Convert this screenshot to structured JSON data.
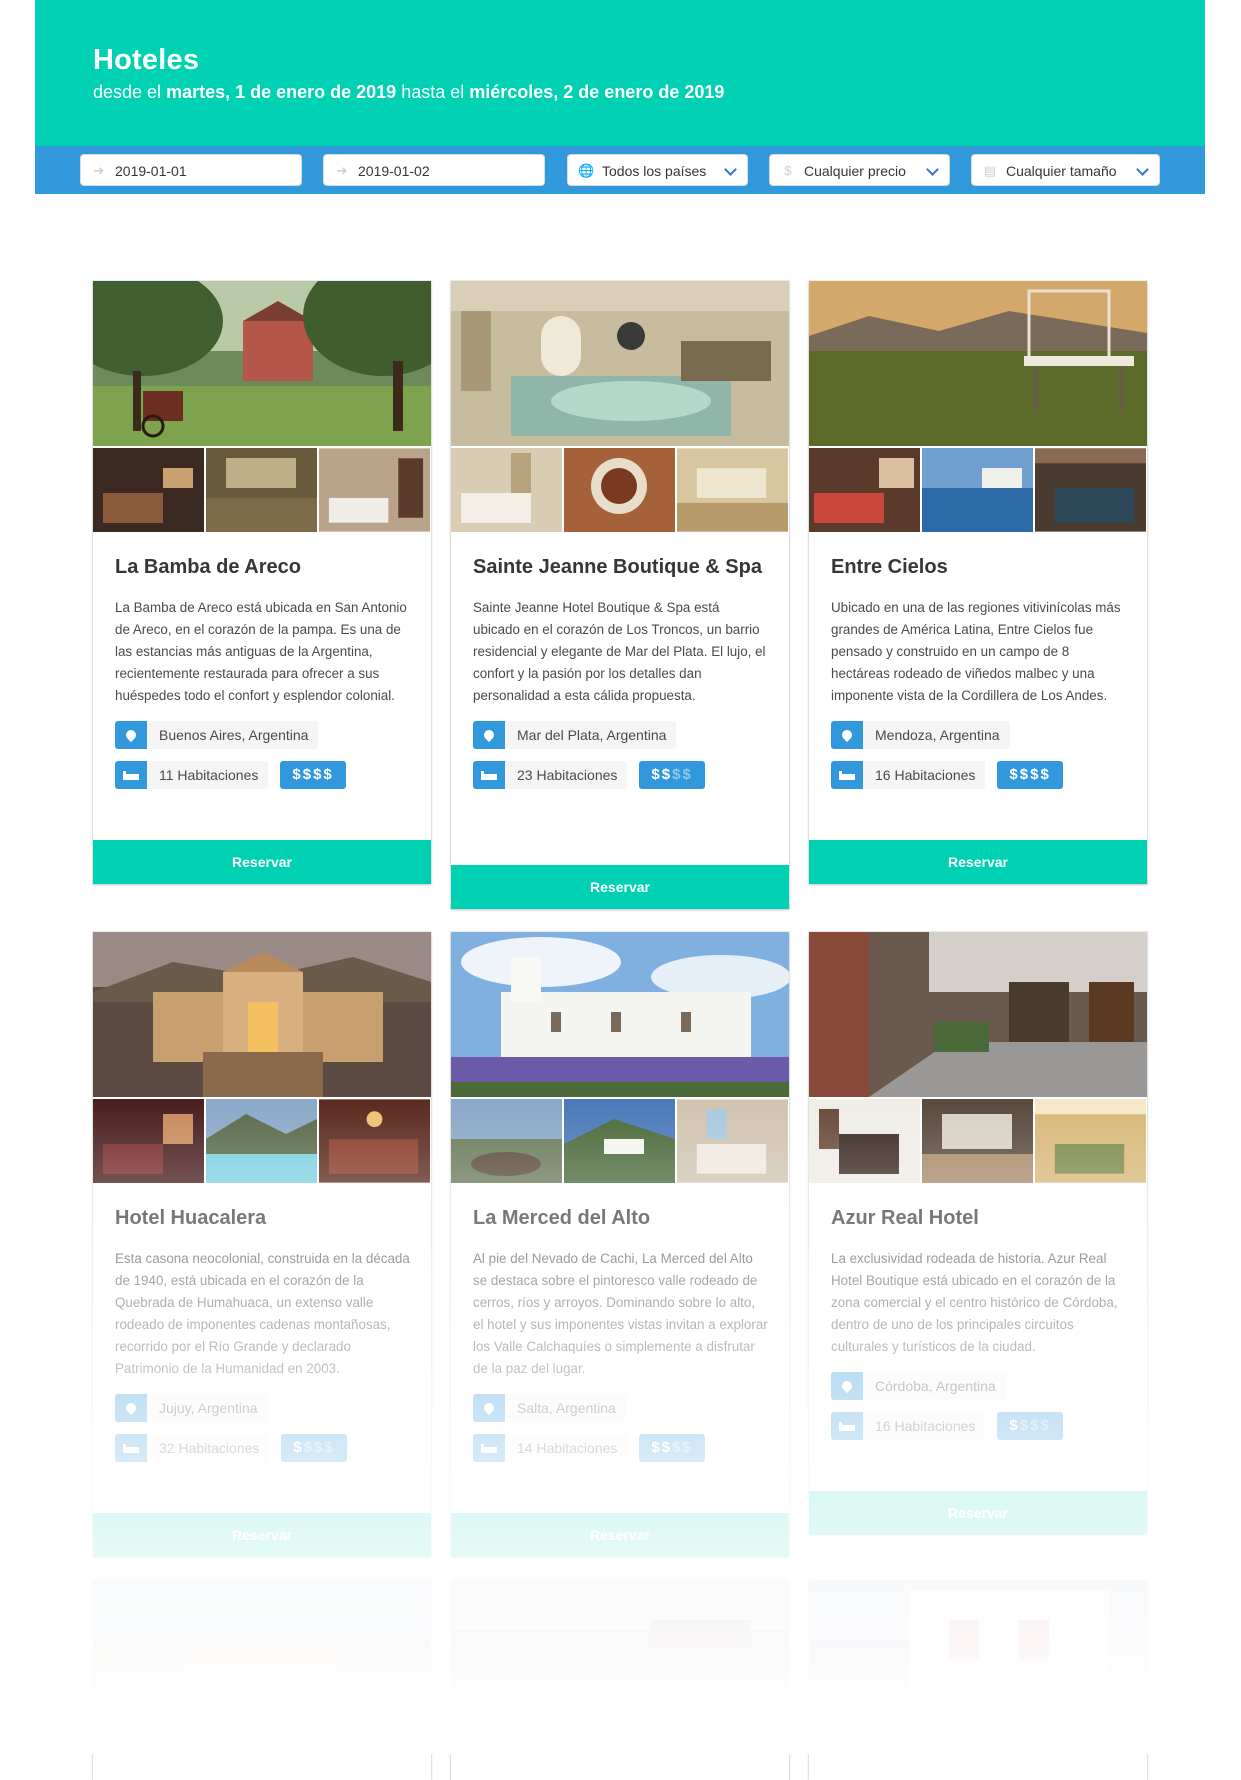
{
  "header": {
    "title": "Hoteles",
    "subtitle_prefix": "desde el ",
    "date_from": "martes, 1 de enero de 2019",
    "subtitle_middle": " hasta el ",
    "date_to": "miércoles, 2 de enero de 2019"
  },
  "filters": {
    "date_from_value": "2019-01-01",
    "date_to_value": "2019-01-02",
    "country_select": "Todos los países",
    "price_select": "Cualquier precio",
    "size_select": "Cualquier tamaño",
    "icons": [
      "sign-in-icon",
      "sign-out-icon",
      "globe-icon",
      "dollar-icon",
      "bed-icon"
    ]
  },
  "reserve_label": "Reservar",
  "colors": {
    "primary": "#00d1b2",
    "info": "#3298dc",
    "link": "#3273dc"
  },
  "hotels": [
    {
      "name": "La Bamba de Areco",
      "description": "La Bamba de Areco está ubicada en San Antonio de Areco, en el corazón de la pampa. Es una de las estancias más antiguas de la Argentina, recientemente restaurada para ofrecer a sus huéspedes todo el confort y esplendor colonial.",
      "location": "Buenos Aires, Argentina",
      "rooms": "11 Habitaciones",
      "price_level": 4,
      "price_max": 4
    },
    {
      "name": "Sainte Jeanne Boutique & Spa",
      "description": "Sainte Jeanne Hotel Boutique & Spa está ubicado en el corazón de Los Troncos, un barrio residencial y elegante de Mar del Plata. El lujo, el confort y la pasión por los detalles dan personalidad a esta cálida propuesta.",
      "location": "Mar del Plata, Argentina",
      "rooms": "23 Habitaciones",
      "price_level": 2,
      "price_max": 4
    },
    {
      "name": "Entre Cielos",
      "description": "Ubicado en una de las regiones vitivinícolas más grandes de América Latina, Entre Cielos fue pensado y construido en un campo de 8 hectáreas rodeado de viñedos malbec y una imponente vista de la Cordillera de Los Andes.",
      "location": "Mendoza, Argentina",
      "rooms": "16 Habitaciones",
      "price_level": 4,
      "price_max": 4
    },
    {
      "name": "Hotel Huacalera",
      "description": "Esta casona neocolonial, construida en la década de 1940, está ubicada en el corazón de la Quebrada de Humahuaca, un extenso valle rodeado de imponentes cadenas montañosas, recorrido por el Río Grande y declarado Patrimonio de la Humanidad en 2003.",
      "location": "Jujuy, Argentina",
      "rooms": "32 Habitaciones",
      "price_level": 1,
      "price_max": 4
    },
    {
      "name": "La Merced del Alto",
      "description": "Al pie del Nevado de Cachi, La Merced del Alto se destaca sobre el pintoresco valle rodeado de cerros, ríos y arroyos. Dominando sobre lo alto, el hotel y sus imponentes vistas invitan a explorar los Valle Calchaquíes o simplemente a disfrutar de la paz del lugar.",
      "location": "Salta, Argentina",
      "rooms": "14 Habitaciones",
      "price_level": 2,
      "price_max": 4
    },
    {
      "name": "Azur Real Hotel",
      "description": "La exclusividad rodeada de historia. Azur Real Hotel Boutique está ubicado en el corazón de la zona comercial y el centro histórico de Córdoba, dentro de uno de los principales circuitos culturales y turísticos de la ciudad.",
      "location": "Córdoba, Argentina",
      "rooms": "16 Habitaciones",
      "price_level": 1,
      "price_max": 4
    }
  ]
}
